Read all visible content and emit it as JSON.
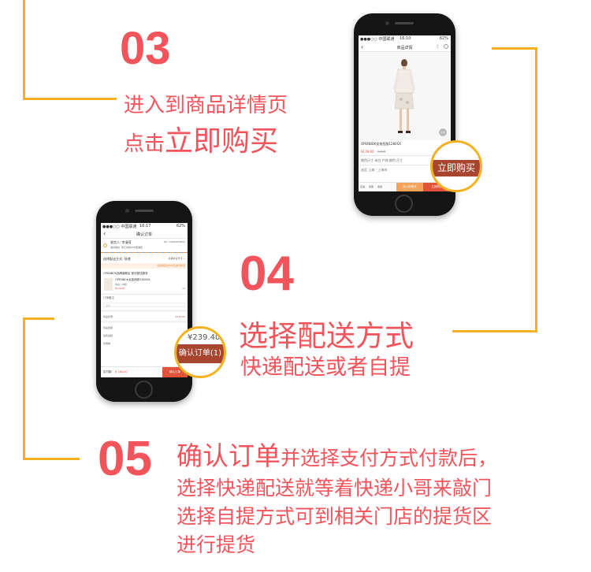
{
  "step03": {
    "number": "03",
    "line1": "进入到商品详情页",
    "line2_small": "点击",
    "line2_big": "立即购买"
  },
  "step04": {
    "number": "04",
    "title": "选择配送方式",
    "subtitle": "快递配送或者自提"
  },
  "step05": {
    "number": "05",
    "title_big": "确认订单",
    "title_rest": "并选择支付方式付款后，",
    "line2": "选择快递配送就等着快递小哥来敲门",
    "line3": "选择自提方式可到相关门店的提货区",
    "line4": "进行提货"
  },
  "phone1": {
    "status_carrier": "●●●○○ 中国联通",
    "status_time": "16:10",
    "status_battery": "62%",
    "nav_title": "商品详情",
    "product_name": "OPENBOX女装西服1280SX",
    "price": "¥179.00",
    "original_price": "¥398",
    "row1": "颜色尺寸  米白 产地 颜色 尺寸",
    "row2": "送至    上海 - 上海市",
    "bottom_icons": [
      "店铺",
      "客服",
      "收藏"
    ],
    "add_cart": "加入购物车",
    "buy_now": "立即购买",
    "badge": "1/4",
    "zoom_label": "立即购买"
  },
  "phone2": {
    "status_carrier": "●●●○○ 中国联通",
    "status_time": "16:17",
    "status_battery": "62%",
    "nav_title": "确认订单",
    "receiver": "收货人: 李清荷",
    "phone_no": "Tel: 13944303823",
    "address": "收货地址: 浙江省杭州市西湖区 ...",
    "delivery_label": "选择配送方式: 快递",
    "delivery_link": "选择收货方式 >",
    "notice": "请选择配送方式及收货时间",
    "shop": "OPENBOX品牌旗舰店 差评配送服务",
    "item_name": "OPENBOX女装西服1280SX",
    "item_spec": "米白 / 均码",
    "item_price": "¥179.00",
    "item_qty": "x1",
    "remark_label": "订单备注",
    "remark_placeholder": "选填",
    "coupon_label": "商品优惠",
    "coupon_value": "¥179.00",
    "sum1_label": "商品金额",
    "sum2_label": "运费金额",
    "sum3_label": "优惠券",
    "total_label": "实付款:",
    "total_value": "¥ 184.00",
    "confirm_btn": "确认订单",
    "zoom_price": "¥239.40",
    "zoom_label": "确认订单(1)"
  }
}
